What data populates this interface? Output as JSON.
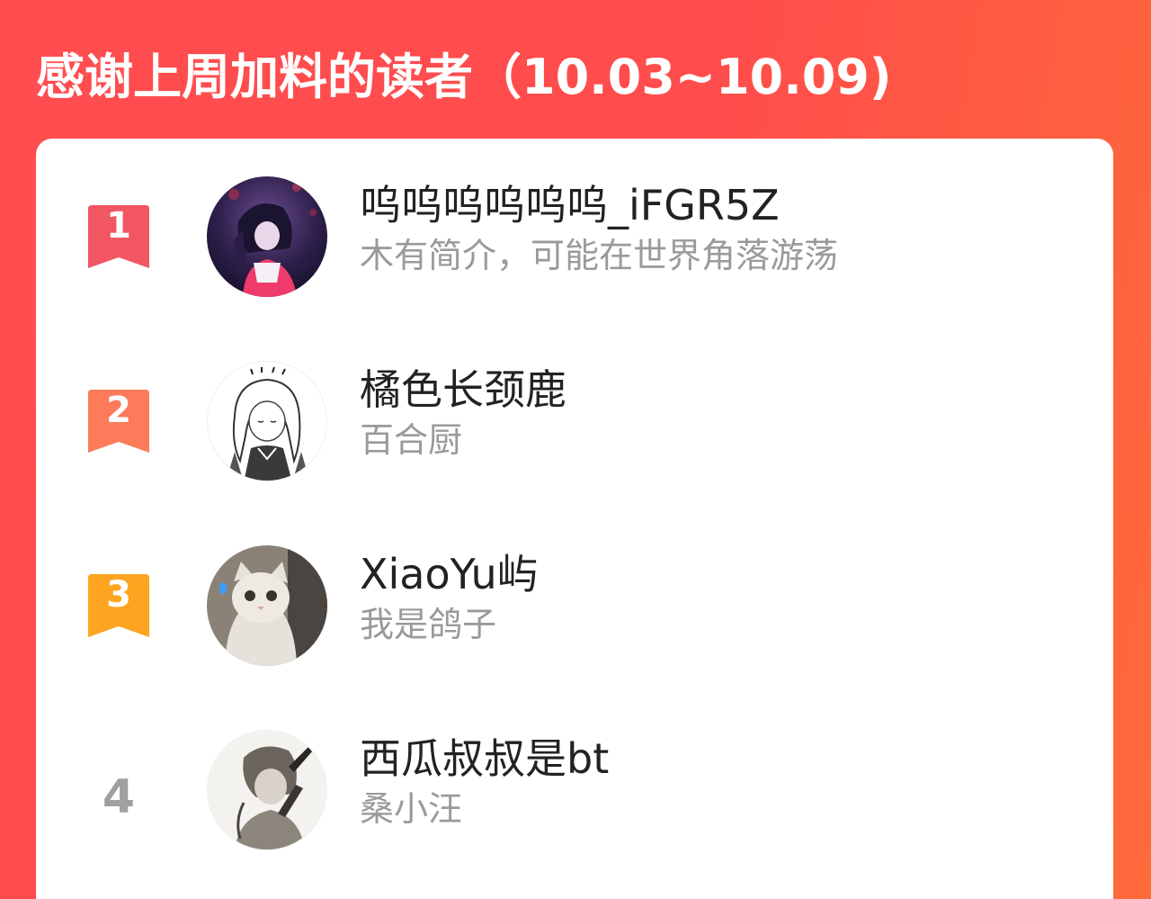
{
  "header": {
    "title": "感谢上周加料的读者（10.03~10.09)"
  },
  "readers": [
    {
      "rank": "1",
      "name": "呜呜呜呜呜呜_iFGR5Z",
      "bio": "木有简介，可能在世界角落游荡",
      "badge_color": "#f25663"
    },
    {
      "rank": "2",
      "name": "橘色长颈鹿",
      "bio": "百合厨",
      "badge_color": "#fb7b5b"
    },
    {
      "rank": "3",
      "name": "XiaoYu屿",
      "bio": "我是鸽子",
      "badge_color": "#fda421"
    },
    {
      "rank": "4",
      "name": "西瓜叔叔是bt",
      "bio": "桑小汪"
    }
  ]
}
